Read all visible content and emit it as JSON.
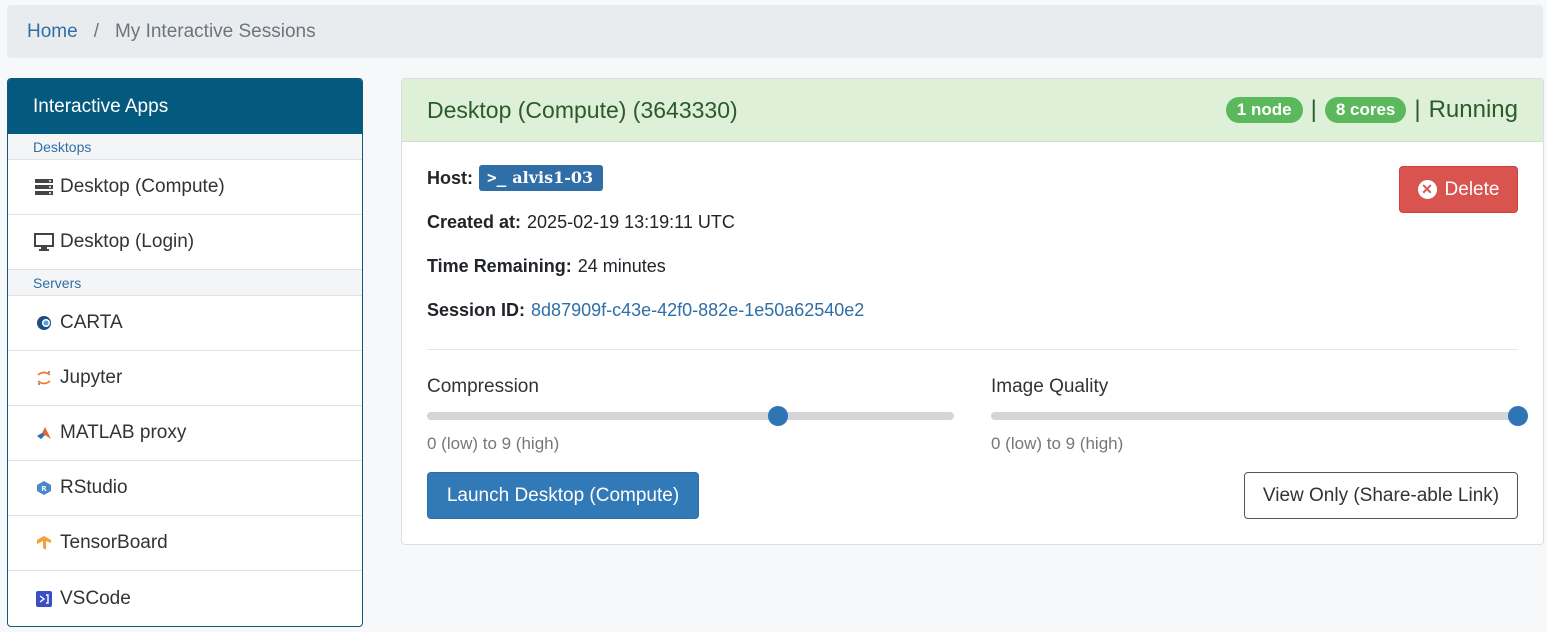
{
  "breadcrumb": {
    "home": "Home",
    "separator": "/",
    "current": "My Interactive Sessions"
  },
  "sidebar": {
    "title": "Interactive Apps",
    "groups": [
      {
        "label": "Desktops",
        "items": [
          {
            "label": "Desktop (Compute)",
            "icon": "server-icon"
          },
          {
            "label": "Desktop (Login)",
            "icon": "monitor-icon"
          }
        ]
      },
      {
        "label": "Servers",
        "items": [
          {
            "label": "CARTA",
            "icon": "carta-icon"
          },
          {
            "label": "Jupyter",
            "icon": "jupyter-icon"
          },
          {
            "label": "MATLAB proxy",
            "icon": "matlab-icon"
          },
          {
            "label": "RStudio",
            "icon": "rstudio-icon"
          },
          {
            "label": "TensorBoard",
            "icon": "tensorboard-icon"
          },
          {
            "label": "VSCode",
            "icon": "vscode-icon"
          }
        ]
      }
    ]
  },
  "session": {
    "title": "Desktop (Compute) (3643330)",
    "nodes": "1 node",
    "cores": "8 cores",
    "status": "Running",
    "host_label": "Host:",
    "host": "alvis1-03",
    "created_label": "Created at:",
    "created": "2025-02-19 13:19:11 UTC",
    "remaining_label": "Time Remaining:",
    "remaining": "24 minutes",
    "session_id_label": "Session ID:",
    "session_id": "8d87909f-c43e-42f0-882e-1e50a62540e2",
    "delete_label": "Delete",
    "compression": {
      "label": "Compression",
      "hint": "0 (low) to 9 (high)",
      "value": 6,
      "min": 0,
      "max": 9
    },
    "quality": {
      "label": "Image Quality",
      "hint": "0 (low) to 9 (high)",
      "value": 9,
      "min": 0,
      "max": 9
    },
    "launch_label": "Launch Desktop (Compute)",
    "view_only_label": "View Only (Share-able Link)"
  },
  "colors": {
    "header_bg": "#045a7e",
    "success": "#5cb85c",
    "danger": "#d9534f",
    "primary": "#3279b7"
  }
}
